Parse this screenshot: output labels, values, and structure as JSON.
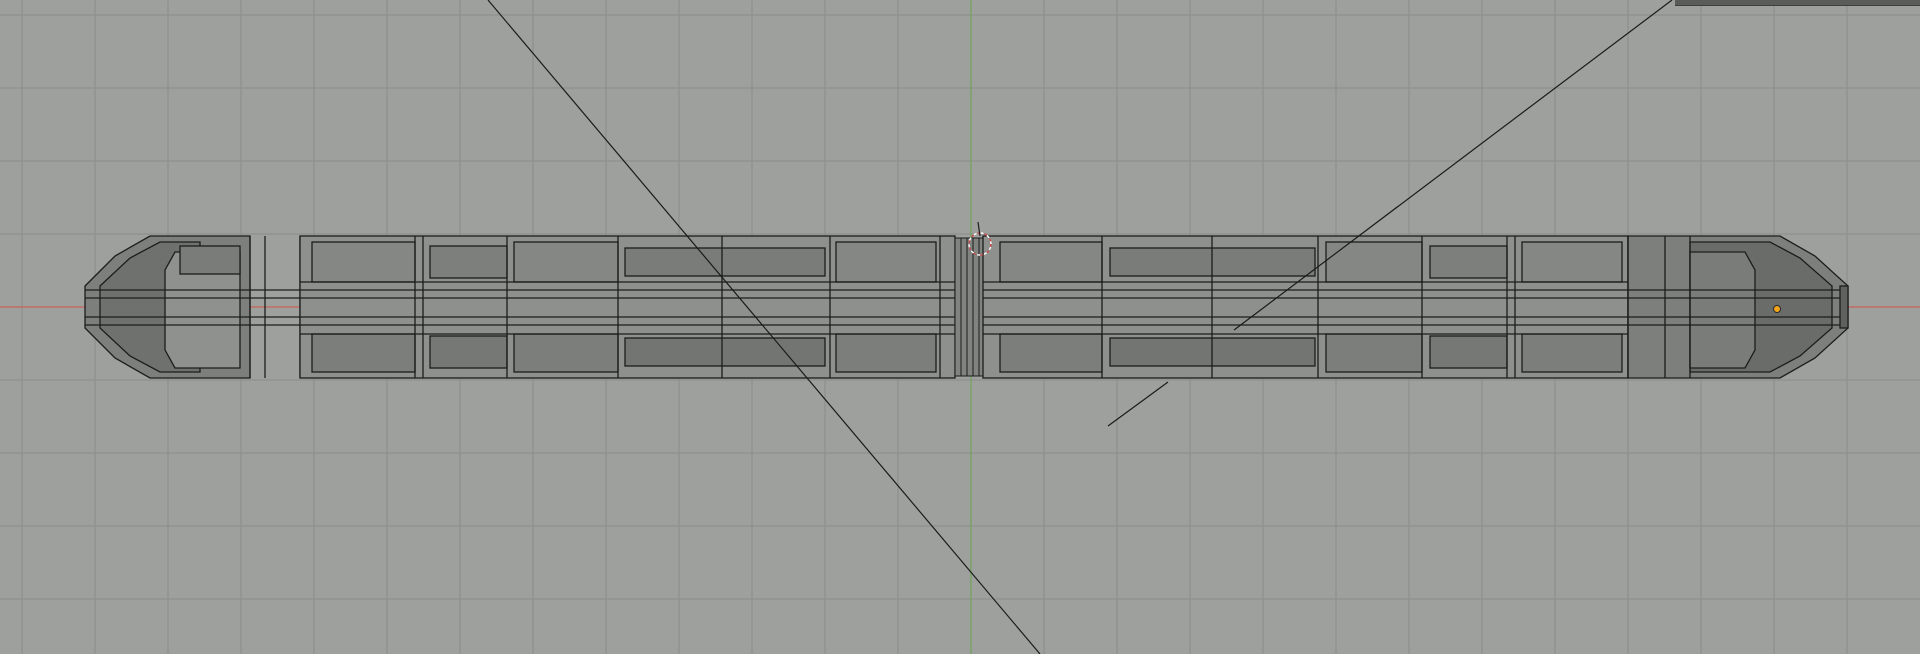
{
  "viewport": {
    "view": "top-orthographic",
    "mode": "edit-wireframe",
    "colors": {
      "background": "#9ea09e",
      "grid_line": "#8b8d8b",
      "x_axis": "#c8625a",
      "y_axis": "#6fa55a",
      "mesh_fill": "#888a88",
      "mesh_fill_dark": "#757775",
      "mesh_edge": "#202020",
      "cursor": "#c84c4c",
      "light_dot": "#f2a51a"
    }
  },
  "objects": [
    {
      "kind": "mesh",
      "name_icon": "train-car-left-mesh"
    },
    {
      "kind": "mesh",
      "name_icon": "train-car-right-mesh"
    },
    {
      "kind": "gangway",
      "name_icon": "coupling-bellows"
    },
    {
      "kind": "camera-guide",
      "name_icon": "camera-frustum-lines"
    },
    {
      "kind": "light",
      "name_icon": "lamp-origin-dot"
    }
  ]
}
